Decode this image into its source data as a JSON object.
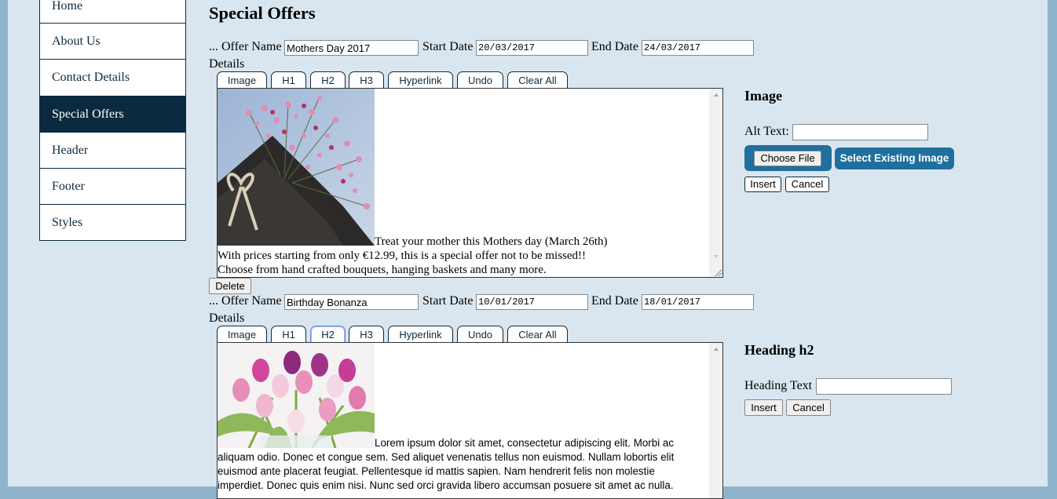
{
  "nav": {
    "items": [
      {
        "label": "Home"
      },
      {
        "label": "About Us"
      },
      {
        "label": "Contact Details"
      },
      {
        "label": "Special Offers"
      },
      {
        "label": "Header"
      },
      {
        "label": "Footer"
      },
      {
        "label": "Styles"
      }
    ],
    "active": "Special Offers"
  },
  "page": {
    "title": "Special Offers"
  },
  "form_labels": {
    "offer_name": "... Offer Name",
    "start_date": "Start Date",
    "end_date": "End Date",
    "details": "Details"
  },
  "toolbar": {
    "tabs": [
      "Image",
      "H1",
      "H2",
      "H3",
      "Hyperlink",
      "Undo",
      "Clear All"
    ]
  },
  "offers": [
    {
      "name": "Mothers Day 2017",
      "start_date": "20/03/2017",
      "end_date": "24/03/2017",
      "text_lines": [
        "Treat your mother this Mothers day (March 26th)",
        "With prices starting from only €12.99, this is a special offer not to be missed!!",
        "Choose from hand crafted bouquets, hanging baskets and many more."
      ],
      "delete_label": "Delete",
      "image_alt": "bouquet of pink gypsophila flowers"
    },
    {
      "name": "Birthday Bonanza",
      "start_date": "10/01/2017",
      "end_date": "18/01/2017",
      "focused_tab": "H2",
      "text_lines": [
        "Lorem ipsum dolor sit amet, consectetur adipiscing elit. Morbi ac",
        "aliquam odio. Donec et congue sem. Sed aliquet venenatis tellus non euismod. Nullam lobortis elit",
        "euismod ante placerat feugiat. Pellentesque id mattis sapien. Nam hendrerit felis non molestie",
        "imperdiet. Donec quis enim nisi. Nunc sed orci gravida libero accumsan posuere sit amet ac nulla."
      ],
      "image_alt": "vase of pink, purple and white tulips"
    }
  ],
  "image_panel": {
    "title": "Image",
    "alt_label": "Alt Text:",
    "alt_value": "",
    "choose_file": "Choose File",
    "select_existing": "Select Existing Image",
    "insert": "Insert",
    "cancel": "Cancel"
  },
  "heading_panel": {
    "title": "Heading h2",
    "text_label": "Heading Text",
    "text_value": "",
    "insert": "Insert",
    "cancel": "Cancel"
  }
}
